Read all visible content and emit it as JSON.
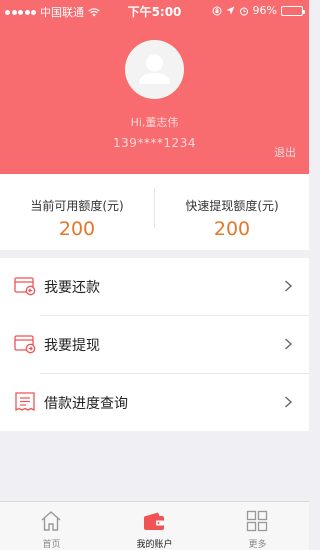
{
  "status_bar": {
    "carrier": "中国联通",
    "time": "下午5:00",
    "battery": "96%",
    "battery_level": 0.96,
    "icons": [
      "signal-dots-icon",
      "wifi-icon",
      "lock-rotation-icon",
      "location-arrow-icon",
      "alarm-icon",
      "battery-icon"
    ]
  },
  "profile": {
    "greeting": "Hi,董志伟",
    "phone": "139****1234",
    "logout": "退出",
    "avatar_icon": "user-avatar-icon"
  },
  "credit": {
    "available_label": "当前可用额度(元)",
    "available_value": "200",
    "quick_label": "快速提现额度(元)",
    "quick_value": "200"
  },
  "menu": {
    "items": [
      {
        "label": "我要还款",
        "icon": "repay-card-icon"
      },
      {
        "label": "我要提现",
        "icon": "withdraw-card-icon"
      },
      {
        "label": "借款进度查询",
        "icon": "receipt-icon"
      }
    ]
  },
  "tabs": [
    {
      "label": "首页",
      "icon": "home-icon",
      "active": false
    },
    {
      "label": "我的账户",
      "icon": "wallet-icon",
      "active": true
    },
    {
      "label": "更多",
      "icon": "grid-icon",
      "active": false
    }
  ],
  "colors": {
    "header": "#f86b6e",
    "accent_value": "#e4772a",
    "active_tab_icon": "#f05356"
  }
}
